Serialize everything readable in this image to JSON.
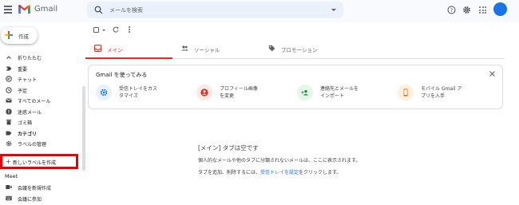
{
  "header": {
    "brand": "Gmail",
    "search_placeholder": "メールを検索"
  },
  "sidebar": {
    "compose_label": "作成",
    "items": [
      {
        "label": "折りたたむ",
        "icon": "chevron-up-icon"
      },
      {
        "label": "重要",
        "icon": "important-icon"
      },
      {
        "label": "チャット",
        "icon": "chat-icon"
      },
      {
        "label": "予定",
        "icon": "scheduled-icon"
      },
      {
        "label": "すべてのメール",
        "icon": "all-mail-icon"
      },
      {
        "label": "迷惑メール",
        "icon": "spam-icon"
      },
      {
        "label": "ゴミ箱",
        "icon": "trash-icon"
      },
      {
        "label": "カテゴリ",
        "icon": "label-icon"
      },
      {
        "label": "ラベルの管理",
        "icon": "gear-icon"
      }
    ],
    "create_label": "新しいラベルを作成",
    "meet_heading": "Meet",
    "meet_items": [
      {
        "label": "会議を新規作成",
        "icon": "video-icon"
      },
      {
        "label": "会議に参加",
        "icon": "keyboard-icon"
      }
    ]
  },
  "tabs": [
    {
      "label": "メイン",
      "icon": "inbox-icon",
      "active": true
    },
    {
      "label": "ソーシャル",
      "icon": "people-icon",
      "active": false
    },
    {
      "label": "プロモーション",
      "icon": "tag-icon",
      "active": false
    }
  ],
  "card": {
    "title": "Gmail を使ってみる",
    "steps": [
      {
        "text": "受信トレイをカス\nタマイズ",
        "icon": "gear-icon",
        "bg": "#e8f0fe",
        "color": "#1a73e8"
      },
      {
        "text": "プロフィール画像\nを変更",
        "icon": "account-icon",
        "bg": "#fce8e6",
        "color": "#d93025"
      },
      {
        "text": "連絡先とメールを\nインポート",
        "icon": "person-add-icon",
        "bg": "#e6f4ea",
        "color": "#1e8e3e"
      },
      {
        "text": "モバイル Gmail ア\nプリを入手",
        "icon": "phone-icon",
        "bg": "#fef0e1",
        "color": "#e8710a"
      }
    ]
  },
  "empty": {
    "title": "[メイン] タブは空です",
    "desc": "個人的なメールや他のタブに分類されないメールは、ここに表示されます。",
    "add_prefix": "タブを追加、削除するには、",
    "add_link": "受信トレイを設定",
    "add_suffix": "をクリックします。"
  },
  "colors": {
    "accent": "#d93025",
    "highlight": "#e60000",
    "link": "#1a73e8"
  }
}
